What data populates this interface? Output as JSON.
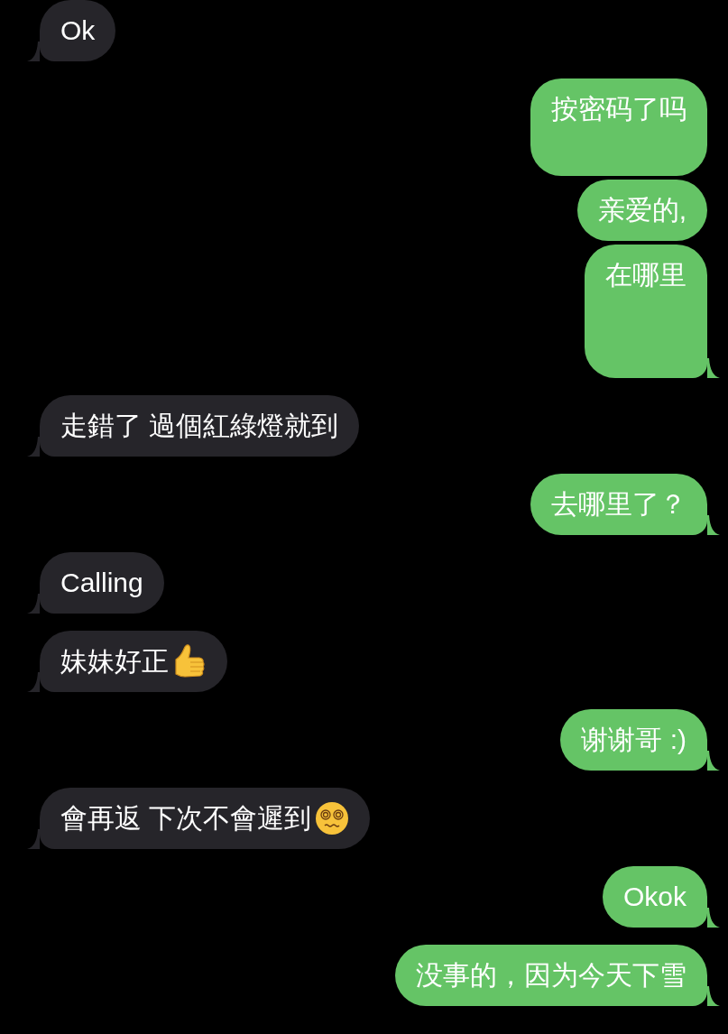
{
  "messages": [
    {
      "outgoing": false,
      "kind": "plain",
      "text": "Ok",
      "tail": true
    },
    {
      "outgoing": true,
      "kind": "plain",
      "text": "按密码了吗\n",
      "tail": false
    },
    {
      "outgoing": true,
      "kind": "plain",
      "text": "亲爱的,",
      "tail": false
    },
    {
      "outgoing": true,
      "kind": "plain",
      "text": "在哪里\n\n",
      "tail": true
    },
    {
      "outgoing": false,
      "kind": "plain",
      "text": "走錯了 過個紅綠燈就到",
      "tail": true
    },
    {
      "outgoing": true,
      "kind": "plain",
      "text": "去哪里了？",
      "tail": true
    },
    {
      "outgoing": false,
      "kind": "plain",
      "text": "Calling",
      "tail": true
    },
    {
      "outgoing": false,
      "kind": "thumbs",
      "text": "妹妹好正",
      "tail": true
    },
    {
      "outgoing": true,
      "kind": "plain",
      "text": "谢谢哥 :)",
      "tail": true
    },
    {
      "outgoing": false,
      "kind": "dizzy",
      "text": "會再返 下次不會遲到",
      "tail": true
    },
    {
      "outgoing": true,
      "kind": "plain",
      "text": "Okok",
      "tail": true
    },
    {
      "outgoing": true,
      "kind": "plain",
      "text": "没事的，因为今天下雪",
      "tail": true
    }
  ]
}
